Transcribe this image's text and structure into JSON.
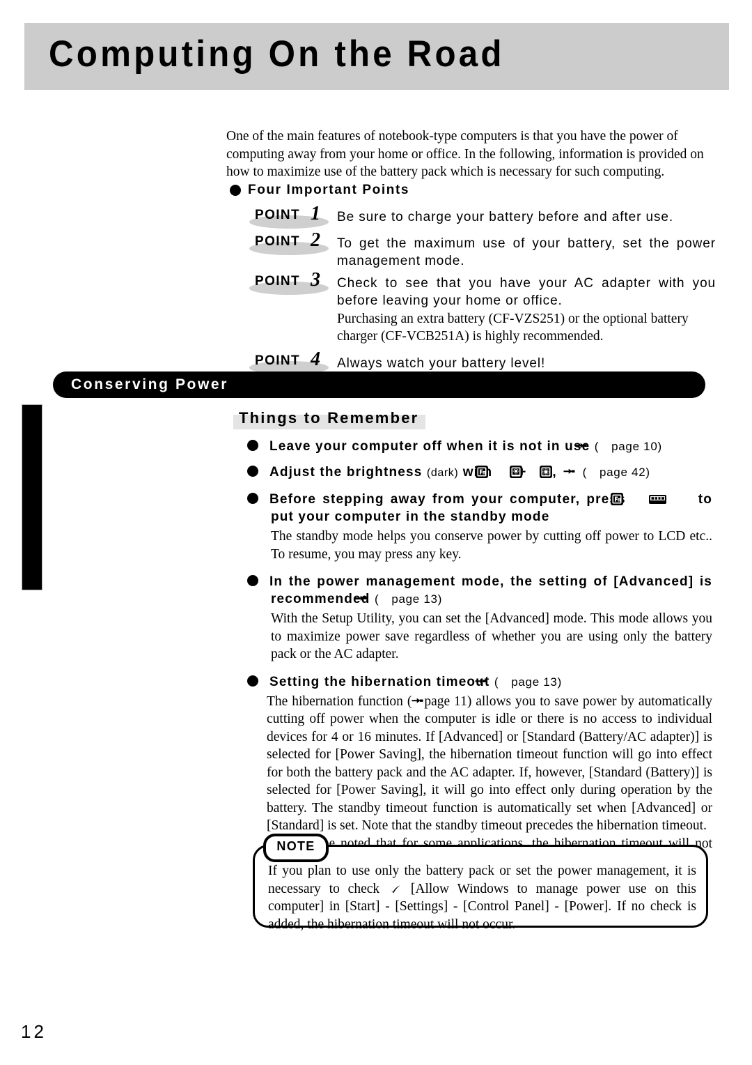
{
  "header": {
    "title": "Computing On the Road"
  },
  "intro": {
    "paragraph": "One of the main features of notebook-type computers is that you have the power of computing away from your home or office.  In the following, information is provided on how to maximize use of the battery pack which is necessary for such computing."
  },
  "four_points": {
    "heading": "Four Important Points",
    "badge_label": "POINT",
    "items": [
      {
        "number": "1",
        "text": "Be sure to charge your battery before and after use."
      },
      {
        "number": "2",
        "text": "To get the maximum use of your battery, set the power management mode."
      },
      {
        "number": "3",
        "text": "Check to see that you have your AC adapter with you before leaving your home or office.",
        "sub": "Purchasing an extra battery (CF-VZS251) or the optional battery charger (CF-VCB251A) is highly recommended."
      },
      {
        "number": "4",
        "text": "Always watch your battery level!"
      }
    ]
  },
  "conserving_power": {
    "bar_label": "Conserving Power",
    "subheading": "Things to Remember",
    "items": [
      {
        "id": "leave-computer-off",
        "head_before": "Leave your computer off when it is not in use",
        "ref": "page 10",
        "body": ""
      },
      {
        "id": "adjust-brightness",
        "head_before": "Adjust the brightness",
        "head_note": "(dark)",
        "head_after": "with",
        "icon_1": "fn-key-icon",
        "plus": "+",
        "icon_2": "brightness-down-key-icon",
        "comma": ",",
        "icon_3": "brightness-up-key-icon",
        "ref": "page 42",
        "body": ""
      },
      {
        "id": "standby-mode",
        "head_before": "Before stepping away from your computer, press",
        "icon_1": "fn-key-icon",
        "plus": "+",
        "icon_2": "spacebar-key-icon",
        "head_after": "to put your computer in the standby mode",
        "body": "The standby mode helps you conserve power by cutting off power to LCD etc.. To resume, you may press any key."
      },
      {
        "id": "advanced-setting",
        "head_before": "In the power management mode, the setting of [Advanced] is recommended",
        "ref": "page 13",
        "body": "With the Setup Utility, you can set the [Advanced] mode.  This mode allows you to maximize power save regardless of whether you are using only the battery pack or the AC adapter."
      },
      {
        "id": "hibernation-timeout",
        "head_before": "Setting the hibernation timeout",
        "ref": "page 13",
        "body_1_a": "The hibernation function (",
        "body_1_ref": "page 11",
        "body_1_b": ") allows you to save power by automatically cutting off power when the computer is idle or there is no access to individual devices for 4 or 16 minutes.  If [Advanced] or [Standard (Battery/AC adapter)] is selected for [Power Saving], the hibernation timeout function will go into effect for both the battery pack and the AC adapter. If, however, [Standard (Battery)] is selected for [Power Saving], it will go into effect only during operation by the battery. The standby timeout function is automatically set when [Advanced] or [Standard] is set. Note that the standby timeout precedes the hibernation timeout.",
        "body_2": "It should be noted that for some applications, the hibernation timeout will not work properly."
      }
    ]
  },
  "note": {
    "label": "NOTE",
    "text_a": "If you plan to use only the battery pack or set the power management, it is necessary to check ",
    "check_icon": "checkmark-icon",
    "text_b": " [Allow Windows to manage power use on this computer] in [Start] - [Settings] - [Control Panel] - [Power].  If no check is added, the hibernation timeout will not occur."
  },
  "footer": {
    "page_number": "12"
  },
  "colors": {
    "banner_gray": "#cccccc",
    "bar_black": "#000000",
    "band_gray": "#e4e4e4",
    "badge_gray": "#cfcfcf"
  }
}
